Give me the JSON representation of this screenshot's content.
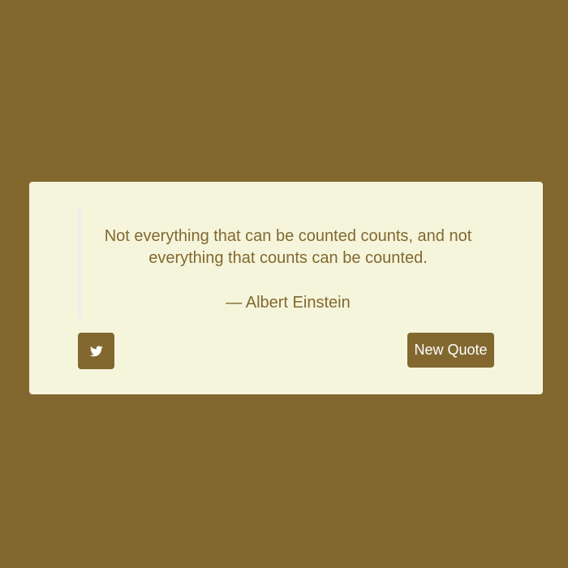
{
  "quote": {
    "text": "Not everything that can be counted counts, and not everything that counts can be counted.",
    "author": "— Albert Einstein"
  },
  "actions": {
    "tweet_icon": "twitter-bird-icon",
    "new_quote_label": "New Quote"
  },
  "colors": {
    "background": "#82682f",
    "card": "#f5f5dc",
    "accent": "#82682f",
    "quote_border": "#eeeeee"
  }
}
